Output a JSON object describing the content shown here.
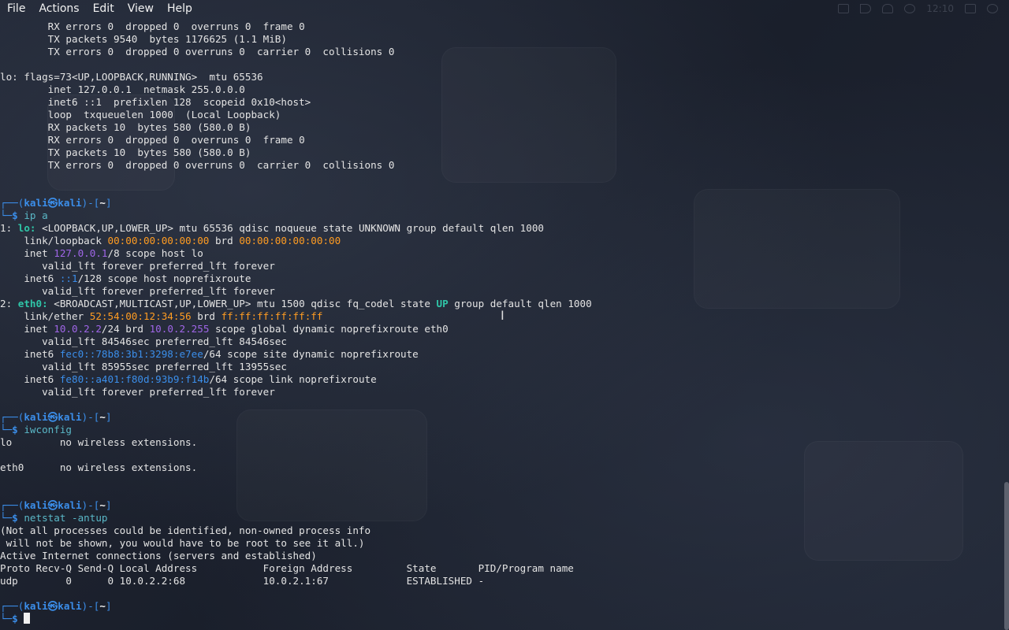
{
  "menu": {
    "file": "File",
    "actions": "Actions",
    "edit": "Edit",
    "view": "View",
    "help": "Help"
  },
  "tray": {
    "clock": "12:10"
  },
  "terminal": {
    "lines": [
      [
        {
          "t": "        RX errors 0  dropped 0  overruns 0  frame 0"
        }
      ],
      [
        {
          "t": "        TX packets 9540  bytes 1176625 (1.1 MiB)"
        }
      ],
      [
        {
          "t": "        TX errors 0  dropped 0 overruns 0  carrier 0  collisions 0"
        }
      ],
      [
        {
          "t": ""
        }
      ],
      [
        {
          "t": "lo: flags=73<UP,LOOPBACK,RUNNING>  mtu 65536"
        }
      ],
      [
        {
          "t": "        inet 127.0.0.1  netmask 255.0.0.0"
        }
      ],
      [
        {
          "t": "        inet6 ::1  prefixlen 128  scopeid 0x10<host>"
        }
      ],
      [
        {
          "t": "        loop  txqueuelen 1000  (Local Loopback)"
        }
      ],
      [
        {
          "t": "        RX packets 10  bytes 580 (580.0 B)"
        }
      ],
      [
        {
          "t": "        RX errors 0  dropped 0  overruns 0  frame 0"
        }
      ],
      [
        {
          "t": "        TX packets 10  bytes 580 (580.0 B)"
        }
      ],
      [
        {
          "t": "        TX errors 0  dropped 0 overruns 0  carrier 0  collisions 0"
        }
      ],
      [
        {
          "t": ""
        }
      ],
      [
        {
          "t": ""
        }
      ],
      [
        {
          "t": "┌──(",
          "c": "c-frame"
        },
        {
          "t": "kali㉿kali",
          "c": "c-user"
        },
        {
          "t": ")-[",
          "c": "c-frame"
        },
        {
          "t": "~",
          "c": "c-path"
        },
        {
          "t": "]",
          "c": "c-frame"
        }
      ],
      [
        {
          "t": "└─",
          "c": "c-frame"
        },
        {
          "t": "$ ",
          "c": "c-bold-blue"
        },
        {
          "t": "ip a",
          "c": "c-cmd"
        }
      ],
      [
        {
          "t": "1: "
        },
        {
          "t": "lo: ",
          "c": "c-cyan"
        },
        {
          "t": "<LOOPBACK,UP,LOWER_UP> mtu 65536 qdisc noqueue state UNKNOWN group default qlen 1000"
        }
      ],
      [
        {
          "t": "    link/loopback "
        },
        {
          "t": "00:00:00:00:00:00",
          "c": "c-orange"
        },
        {
          "t": " brd "
        },
        {
          "t": "00:00:00:00:00:00",
          "c": "c-orange"
        }
      ],
      [
        {
          "t": "    inet "
        },
        {
          "t": "127.0.0.1",
          "c": "c-purple"
        },
        {
          "t": "/8 scope host lo"
        }
      ],
      [
        {
          "t": "       valid_lft forever preferred_lft forever"
        }
      ],
      [
        {
          "t": "    inet6 "
        },
        {
          "t": "::1",
          "c": "c-pblue"
        },
        {
          "t": "/128 scope host noprefixroute"
        }
      ],
      [
        {
          "t": "       valid_lft forever preferred_lft forever"
        }
      ],
      [
        {
          "t": "2: "
        },
        {
          "t": "eth0: ",
          "c": "c-cyan"
        },
        {
          "t": "<BROADCAST,MULTICAST,UP,LOWER_UP> mtu 1500 qdisc fq_codel state "
        },
        {
          "t": "UP",
          "c": "c-cyan"
        },
        {
          "t": " group default qlen 1000"
        }
      ],
      [
        {
          "t": "    link/ether "
        },
        {
          "t": "52:54:00:12:34:56",
          "c": "c-orange"
        },
        {
          "t": " brd "
        },
        {
          "t": "ff:ff:ff:ff:ff:ff",
          "c": "c-orange"
        }
      ],
      [
        {
          "t": "    inet "
        },
        {
          "t": "10.0.2.2",
          "c": "c-purple"
        },
        {
          "t": "/24 brd "
        },
        {
          "t": "10.0.2.255",
          "c": "c-purple"
        },
        {
          "t": " scope global dynamic noprefixroute eth0"
        }
      ],
      [
        {
          "t": "       valid_lft 84546sec preferred_lft 84546sec"
        }
      ],
      [
        {
          "t": "    inet6 "
        },
        {
          "t": "fec0::78b8:3b1:3298:e7ee",
          "c": "c-pblue"
        },
        {
          "t": "/64 scope site dynamic noprefixroute"
        }
      ],
      [
        {
          "t": "       valid_lft 85955sec preferred_lft 13955sec"
        }
      ],
      [
        {
          "t": "    inet6 "
        },
        {
          "t": "fe80::a401:f80d:93b9:f14b",
          "c": "c-pblue"
        },
        {
          "t": "/64 scope link noprefixroute"
        }
      ],
      [
        {
          "t": "       valid_lft forever preferred_lft forever"
        }
      ],
      [
        {
          "t": ""
        }
      ],
      [
        {
          "t": "┌──(",
          "c": "c-frame"
        },
        {
          "t": "kali㉿kali",
          "c": "c-user"
        },
        {
          "t": ")-[",
          "c": "c-frame"
        },
        {
          "t": "~",
          "c": "c-path"
        },
        {
          "t": "]",
          "c": "c-frame"
        }
      ],
      [
        {
          "t": "└─",
          "c": "c-frame"
        },
        {
          "t": "$ ",
          "c": "c-bold-blue"
        },
        {
          "t": "iwconfig",
          "c": "c-cmd"
        }
      ],
      [
        {
          "t": "lo        no wireless extensions."
        }
      ],
      [
        {
          "t": ""
        }
      ],
      [
        {
          "t": "eth0      no wireless extensions."
        }
      ],
      [
        {
          "t": ""
        }
      ],
      [
        {
          "t": ""
        }
      ],
      [
        {
          "t": "┌──(",
          "c": "c-frame"
        },
        {
          "t": "kali㉿kali",
          "c": "c-user"
        },
        {
          "t": ")-[",
          "c": "c-frame"
        },
        {
          "t": "~",
          "c": "c-path"
        },
        {
          "t": "]",
          "c": "c-frame"
        }
      ],
      [
        {
          "t": "└─",
          "c": "c-frame"
        },
        {
          "t": "$ ",
          "c": "c-bold-blue"
        },
        {
          "t": "netstat -antup",
          "c": "c-cmd"
        }
      ],
      [
        {
          "t": "(Not all processes could be identified, non-owned process info"
        }
      ],
      [
        {
          "t": " will not be shown, you would have to be root to see it all.)"
        }
      ],
      [
        {
          "t": "Active Internet connections (servers and established)"
        }
      ],
      [
        {
          "t": "Proto Recv-Q Send-Q Local Address           Foreign Address         State       PID/Program name"
        }
      ],
      [
        {
          "t": "udp        0      0 10.0.2.2:68             10.0.2.1:67             ESTABLISHED -"
        }
      ],
      [
        {
          "t": ""
        }
      ],
      [
        {
          "t": "┌──(",
          "c": "c-frame"
        },
        {
          "t": "kali㉿kali",
          "c": "c-user"
        },
        {
          "t": ")-[",
          "c": "c-frame"
        },
        {
          "t": "~",
          "c": "c-path"
        },
        {
          "t": "]",
          "c": "c-frame"
        }
      ],
      [
        {
          "t": "└─",
          "c": "c-frame"
        },
        {
          "t": "$ ",
          "c": "c-bold-blue"
        }
      ]
    ]
  }
}
